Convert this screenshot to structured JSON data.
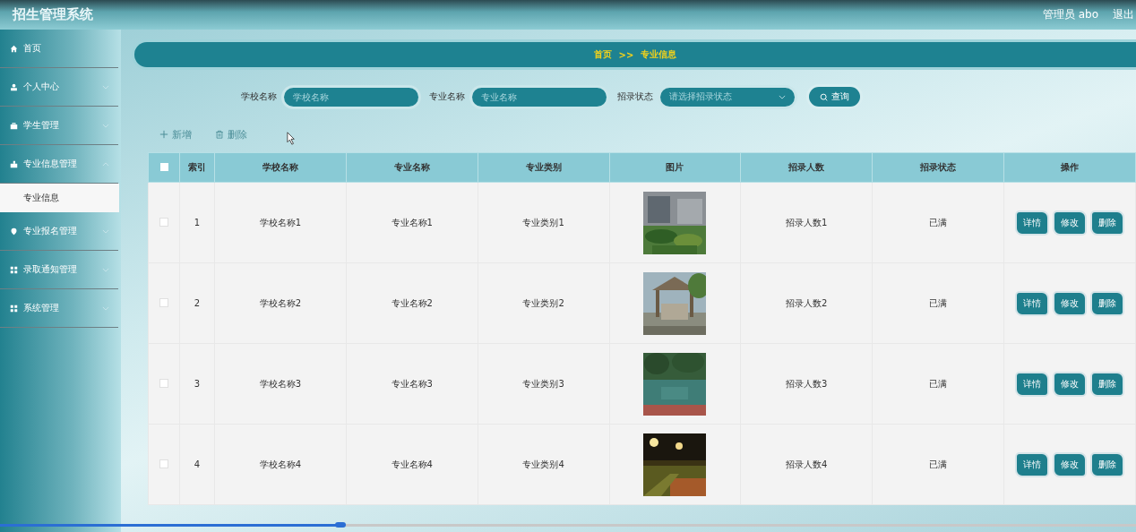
{
  "header": {
    "title": "招生管理系统",
    "user": "管理员 abo",
    "logout": "退出"
  },
  "sidebar": {
    "items": [
      {
        "label": "首页",
        "kind": "home",
        "expandable": false
      },
      {
        "label": "个人中心",
        "kind": "user",
        "expandable": true,
        "expanded": false
      },
      {
        "label": "学生管理",
        "kind": "case",
        "expandable": true,
        "expanded": false
      },
      {
        "label": "专业信息管理",
        "kind": "hand",
        "expandable": true,
        "expanded": true,
        "children": [
          {
            "label": "专业信息",
            "selected": true
          }
        ]
      },
      {
        "label": "专业报名管理",
        "kind": "pin",
        "expandable": true,
        "expanded": false
      },
      {
        "label": "录取通知管理",
        "kind": "grid",
        "expandable": true,
        "expanded": false
      },
      {
        "label": "系统管理",
        "kind": "grid",
        "expandable": true,
        "expanded": false
      }
    ]
  },
  "breadcrumb": [
    "首页",
    ">>",
    "专业信息"
  ],
  "search": {
    "fields": [
      {
        "label": "学校名称",
        "placeholder": "学校名称",
        "kind": "input"
      },
      {
        "label": "专业名称",
        "placeholder": "专业名称",
        "kind": "input"
      },
      {
        "label": "招录状态",
        "placeholder": "请选择招录状态",
        "kind": "select"
      }
    ],
    "button": "查询"
  },
  "actions": [
    {
      "label": "新增",
      "kind": "add"
    },
    {
      "label": "删除",
      "kind": "delete"
    }
  ],
  "table": {
    "select_all": {
      "checked": false
    },
    "columns": [
      "索引",
      "学校名称",
      "专业名称",
      "专业类别",
      "图片",
      "招录人数",
      "招录状态",
      "操作"
    ],
    "rows": [
      {
        "checked": false,
        "index": "1",
        "school": "学校名称1",
        "major": "专业名称1",
        "category": "专业类别1",
        "image": {
          "kind": "picture"
        },
        "count": "招录人数1",
        "status": "已满",
        "buttons": [
          "详情",
          "修改",
          "删除"
        ]
      },
      {
        "checked": false,
        "index": "2",
        "school": "学校名称2",
        "major": "专业名称2",
        "category": "专业类别2",
        "image": {
          "kind": "picture"
        },
        "count": "招录人数2",
        "status": "已满",
        "buttons": [
          "详情",
          "修改",
          "删除"
        ]
      },
      {
        "checked": false,
        "index": "3",
        "school": "学校名称3",
        "major": "专业名称3",
        "category": "专业类别3",
        "image": {
          "kind": "picture"
        },
        "count": "招录人数3",
        "status": "已满",
        "buttons": [
          "详情",
          "修改",
          "删除"
        ]
      },
      {
        "checked": false,
        "index": "4",
        "school": "学校名称4",
        "major": "专业名称4",
        "category": "专业类别4",
        "image": {
          "kind": "picture"
        },
        "count": "招录人数4",
        "status": "已满",
        "buttons": [
          "详情",
          "修改",
          "删除"
        ]
      }
    ]
  },
  "video_progress": {
    "level": 0.3
  }
}
